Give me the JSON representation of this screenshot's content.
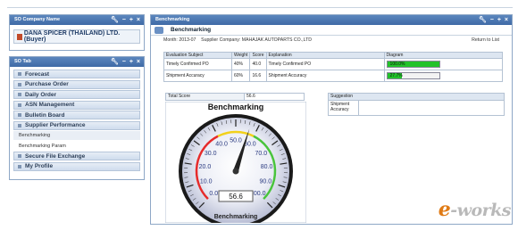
{
  "company_portlet": {
    "title": "SO Company Name",
    "company": "DANA SPICER (THAILAND) LTD.(Buyer)"
  },
  "menu_portlet": {
    "title": "SO Tab",
    "items": [
      {
        "label": "Forecast"
      },
      {
        "label": "Purchase Order"
      },
      {
        "label": "Daily Order"
      },
      {
        "label": "ASN Management"
      },
      {
        "label": "Bulletin Board"
      },
      {
        "label": "Supplier Performance"
      }
    ],
    "sub_items": [
      {
        "label": "Benchmarking"
      },
      {
        "label": "Benchmarking Param"
      }
    ],
    "items_after": [
      {
        "label": "Secure File Exchange"
      },
      {
        "label": "My Profile"
      }
    ]
  },
  "tools": {
    "wrench": "wrench-icon",
    "minus": "−",
    "plus": "+",
    "close": "×"
  },
  "bench_portlet": {
    "title": "Benchmarking",
    "heading": "Benchmarking",
    "month_label": "Month:",
    "month": "2013-07",
    "supplier_label": "Supplier Company:",
    "supplier": "MAHAJAK AUTOPARTS CO.,LTD",
    "return_label": "Return to List",
    "table": {
      "headers": [
        "Evaluation Subject",
        "Weight",
        "Score",
        "Explanation",
        "Diagram"
      ],
      "rows": [
        {
          "subject": "Timely Confirmed PO",
          "weight": "40%",
          "score": "40.0",
          "explanation": "Timely Confirmed PO",
          "diagram": "100.0%",
          "pct": 100
        },
        {
          "subject": "Shipment Accuracy",
          "weight": "60%",
          "score": "16.6",
          "explanation": "Shipment Accuracy",
          "diagram": "27.7%",
          "pct": 27.7
        }
      ]
    },
    "total_label": "Total Score",
    "total_value": "56.6",
    "suggestion_label": "Suggestion",
    "suggestion_key": "Shipment Accuracy",
    "suggestion_value": ""
  },
  "gauge": {
    "title": "Benchmarking",
    "bottom_label": "Benchmarking",
    "value": 56.6,
    "value_text": "56.6",
    "min": 0,
    "max": 100,
    "major_ticks": [
      "0.0",
      "10.0",
      "20.0",
      "30.0",
      "40.0",
      "50.0",
      "60.0",
      "70.0",
      "80.0",
      "90.0",
      "100.0"
    ],
    "colors": {
      "red": "#e62b2b",
      "yellow": "#f2d11b",
      "green": "#49c43c"
    }
  },
  "watermark": {
    "e": "e",
    "rest": "-works"
  }
}
